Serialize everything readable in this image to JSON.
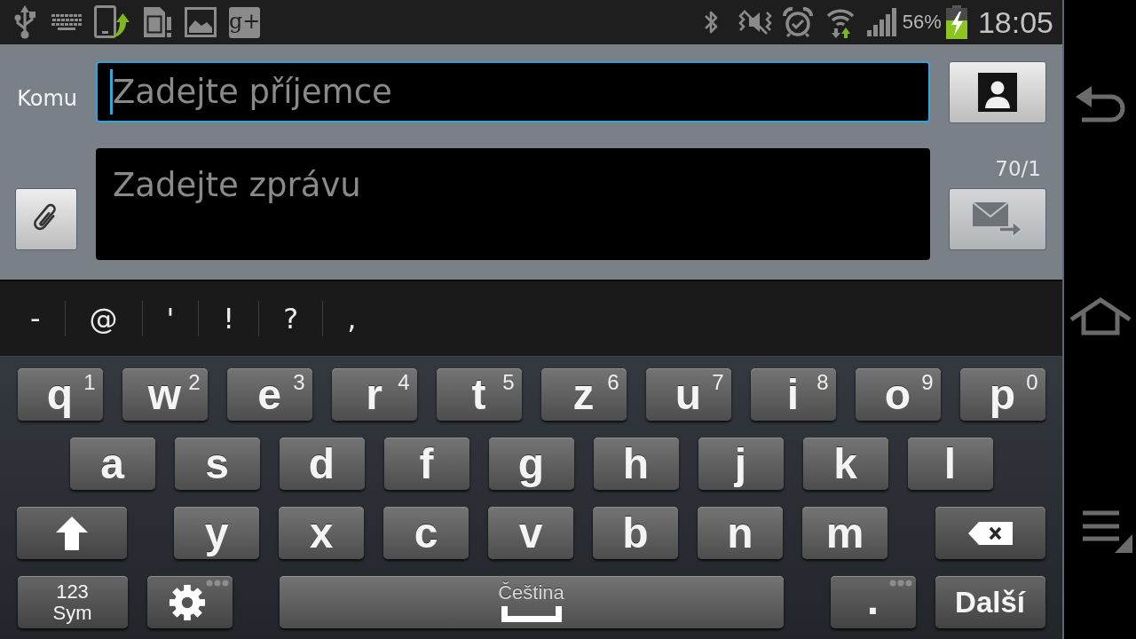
{
  "status_bar": {
    "tile_text": "g+",
    "battery_percent": "56%",
    "time": "18:05"
  },
  "compose": {
    "recipient": {
      "label": "Komu",
      "placeholder": "Zadejte příjemce",
      "focused": true
    },
    "message": {
      "placeholder": "Zadejte zprávu",
      "focused": false
    },
    "counter": "70/1",
    "send_button": {
      "disabled": true
    }
  },
  "symbol_bar": {
    "symbols": [
      "-",
      "@",
      "'",
      "!",
      "?",
      ","
    ]
  },
  "keyboard": {
    "rows": [
      {
        "keys": [
          {
            "kind": "letter",
            "label": "q",
            "hint": "1"
          },
          {
            "kind": "letter",
            "label": "w",
            "hint": "2"
          },
          {
            "kind": "letter",
            "label": "e",
            "hint": "3"
          },
          {
            "kind": "letter",
            "label": "r",
            "hint": "4"
          },
          {
            "kind": "letter",
            "label": "t",
            "hint": "5"
          },
          {
            "kind": "letter",
            "label": "z",
            "hint": "6"
          },
          {
            "kind": "letter",
            "label": "u",
            "hint": "7"
          },
          {
            "kind": "letter",
            "label": "i",
            "hint": "8"
          },
          {
            "kind": "letter",
            "label": "o",
            "hint": "9"
          },
          {
            "kind": "letter",
            "label": "p",
            "hint": "0"
          }
        ]
      },
      {
        "keys": [
          {
            "kind": "letter",
            "label": "a"
          },
          {
            "kind": "letter",
            "label": "s"
          },
          {
            "kind": "letter",
            "label": "d"
          },
          {
            "kind": "letter",
            "label": "f"
          },
          {
            "kind": "letter",
            "label": "g"
          },
          {
            "kind": "letter",
            "label": "h"
          },
          {
            "kind": "letter",
            "label": "j"
          },
          {
            "kind": "letter",
            "label": "k"
          },
          {
            "kind": "letter",
            "label": "l"
          }
        ]
      },
      {
        "keys": [
          {
            "kind": "shift"
          },
          {
            "kind": "letter",
            "label": "y"
          },
          {
            "kind": "letter",
            "label": "x"
          },
          {
            "kind": "letter",
            "label": "c"
          },
          {
            "kind": "letter",
            "label": "v"
          },
          {
            "kind": "letter",
            "label": "b"
          },
          {
            "kind": "letter",
            "label": "n"
          },
          {
            "kind": "letter",
            "label": "m"
          },
          {
            "kind": "backspace"
          }
        ]
      },
      {
        "keys": [
          {
            "kind": "symbols",
            "label": "123 Sym"
          },
          {
            "kind": "settings",
            "more": true
          },
          {
            "kind": "space",
            "label": "Čeština"
          },
          {
            "kind": "period",
            "label": ".",
            "more": true
          },
          {
            "kind": "action",
            "label": "Další"
          }
        ]
      }
    ]
  }
}
